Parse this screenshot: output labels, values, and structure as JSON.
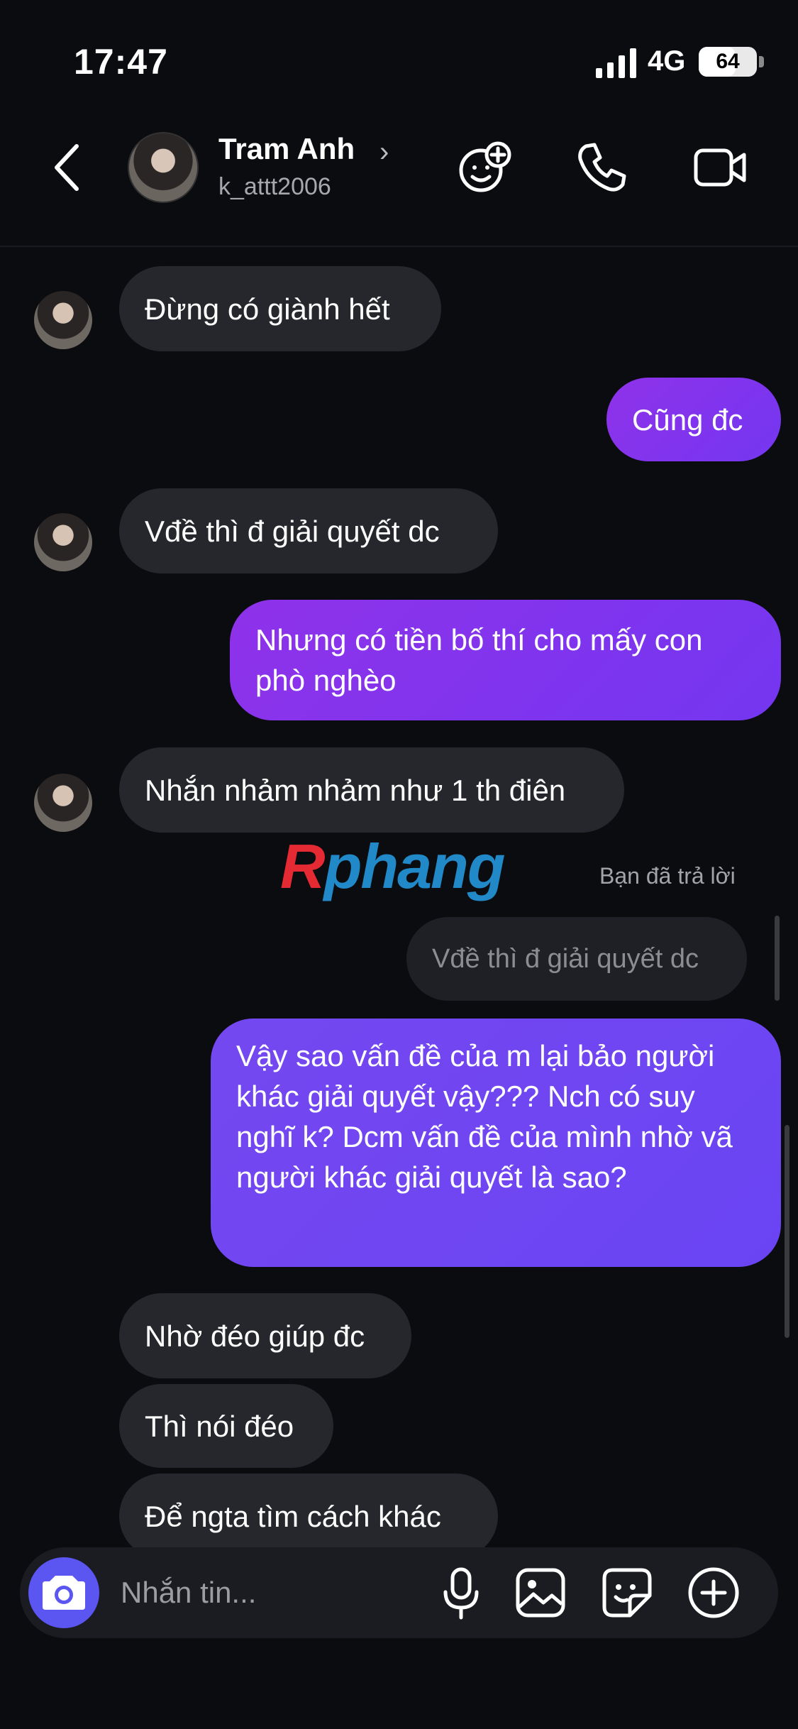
{
  "status_bar": {
    "time": "17:47",
    "network": "4G",
    "battery": "64",
    "battery_level": 0.64
  },
  "header": {
    "contact_name": "Tram Anh",
    "contact_handle": "k_attt2006",
    "icons": [
      "back-icon",
      "add-friend-icon",
      "phone-icon",
      "video-icon"
    ]
  },
  "messages": [
    {
      "side": "in",
      "text": "Đừng có giành hết"
    },
    {
      "side": "out",
      "text": "Cũng đc"
    },
    {
      "side": "in",
      "text": "Vđề thì đ giải quyết dc"
    },
    {
      "side": "out",
      "text": "Nhưng có tiền bố thí cho mấy con phò nghèo"
    },
    {
      "side": "in",
      "text": "Nhắn nhảm nhảm như 1 th điên"
    },
    {
      "side": "reply_label",
      "text": "Bạn đã trả lời"
    },
    {
      "side": "reply_quote",
      "text": "Vđề thì đ giải quyết dc"
    },
    {
      "side": "out",
      "text": "Vậy sao vấn đề của m lại bảo người khác giải quyết vậy??? Nch có suy nghĩ k? Dcm vấn đề của mình nhờ vã người khác giải quyết là sao?"
    },
    {
      "side": "in",
      "text": "Nhờ đéo giúp đc"
    },
    {
      "side": "in",
      "text": "Thì nói đéo"
    },
    {
      "side": "in",
      "text": "Để ngta tìm cách khác"
    }
  ],
  "watermark": {
    "first": "R",
    "rest": "phang"
  },
  "composer": {
    "placeholder": "Nhắn tin...",
    "icons": [
      "camera-icon",
      "microphone-icon",
      "gallery-icon",
      "sticker-icon",
      "add-icon"
    ]
  },
  "colors": {
    "background": "#0b0c10",
    "incoming_bubble": "#26272c",
    "outgoing_bubble": "#8f32ea",
    "outgoing_bubble_alt": "#6a44f3",
    "camera_button": "#5b55f2"
  }
}
